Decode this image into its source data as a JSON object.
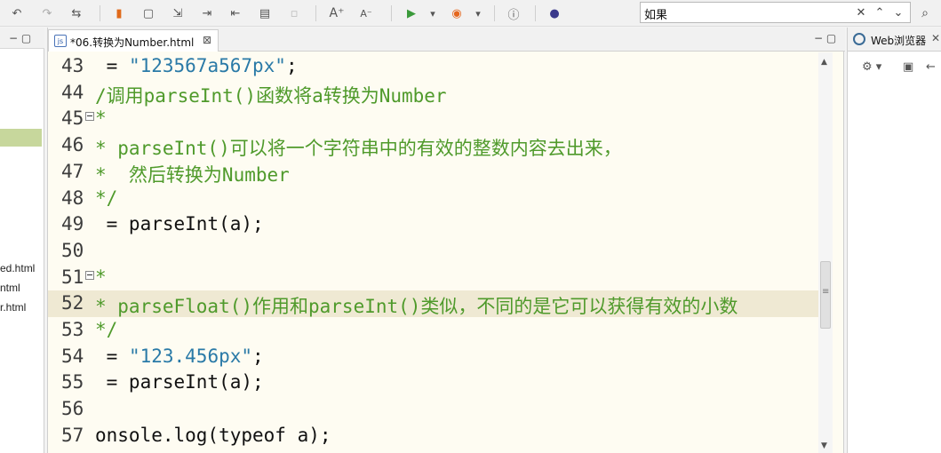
{
  "toolbar": {
    "icons": [
      "back-icon",
      "forward-icon",
      "last-edit-icon",
      "bookmark-icon",
      "new-file-icon",
      "export-icon",
      "step-into-icon",
      "step-return-icon",
      "console-icon",
      "disabled-icon",
      "increase-font-icon",
      "decrease-font-icon",
      "run-icon",
      "dropdown-icon",
      "firefox-icon",
      "dropdown-icon",
      "info-icon",
      "eclipse-icon"
    ],
    "glyphs": {
      "back": "↶",
      "forward": "↷",
      "last_edit": "⇆",
      "bookmark": "▮",
      "new_file": "▢",
      "export": "⇲",
      "step_into": "⇥",
      "step_return": "⇤",
      "console": "▤",
      "disabled": "▫",
      "font_up": "A⁺",
      "font_down": "A⁻",
      "run": "▶",
      "caret": "▾",
      "browser": "◉",
      "info": "ⓘ",
      "globe": "●"
    }
  },
  "search": {
    "value": "如果",
    "clear": "✕",
    "prev": "⌃",
    "next": "⌄",
    "global": "⌕"
  },
  "left_panel": {
    "window_controls": "− ▢",
    "files": [
      "ed.html",
      "ntml",
      "r.html"
    ]
  },
  "editor": {
    "tab_label": "*06.转换为Number.html",
    "tab_close": "⊠",
    "tab_icon": "js",
    "window_controls": "− ▢",
    "lines": [
      {
        "num": "43",
        "fold": "",
        "text": " = \"123567a567px\";",
        "kind": "mixed43"
      },
      {
        "num": "44",
        "fold": "",
        "text": "/调用parseInt()函数将a转换为Number",
        "kind": "comment"
      },
      {
        "num": "45",
        "fold": "⊟",
        "text": "*",
        "kind": "comment"
      },
      {
        "num": "46",
        "fold": "",
        "text": "* parseInt()可以将一个字符串中的有效的整数内容去出来，",
        "kind": "comment"
      },
      {
        "num": "47",
        "fold": "",
        "text": "*  然后转换为Number",
        "kind": "comment"
      },
      {
        "num": "48",
        "fold": "",
        "text": "*/",
        "kind": "comment"
      },
      {
        "num": "49",
        "fold": "",
        "text": " = parseInt(a);",
        "kind": "plain"
      },
      {
        "num": "50",
        "fold": "",
        "text": "",
        "kind": "plain"
      },
      {
        "num": "51",
        "fold": "⊟",
        "text": "*",
        "kind": "comment"
      },
      {
        "num": "52",
        "fold": "",
        "text": "* parseFloat()作用和parseInt()类似，不同的是它可以获得有效的小数",
        "kind": "comment"
      },
      {
        "num": "53",
        "fold": "",
        "text": "*/",
        "kind": "comment"
      },
      {
        "num": "54",
        "fold": "",
        "text": " = \"123.456px\";",
        "kind": "mixed54"
      },
      {
        "num": "55",
        "fold": "",
        "text": " = parseInt(a);",
        "kind": "plain"
      },
      {
        "num": "56",
        "fold": "",
        "text": "",
        "kind": "plain"
      },
      {
        "num": "57",
        "fold": "",
        "text": "onsole.log(typeof a);",
        "kind": "plain"
      }
    ],
    "highlighted_line": "52",
    "scroll_up": "▲",
    "scroll_down": "▼",
    "scroll_grip": "≡"
  },
  "right_panel": {
    "title": "Web浏览器",
    "close": "✕",
    "tools": [
      "⚙ ▾",
      "▣",
      "←"
    ]
  }
}
